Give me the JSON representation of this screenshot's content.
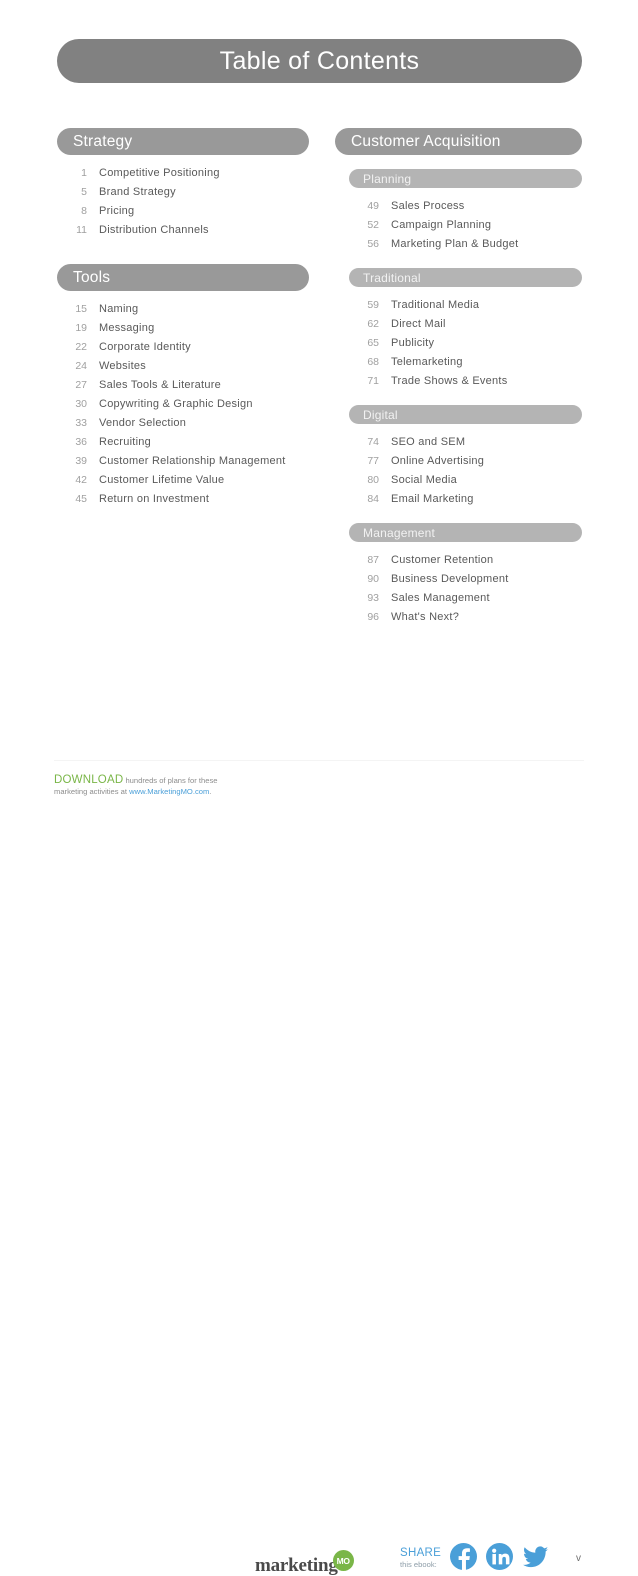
{
  "page": {
    "title": "Table of Contents",
    "page_number": "v"
  },
  "left_column": {
    "sections": [
      {
        "heading": "Strategy",
        "entries": [
          {
            "page": "1",
            "title": "Competitive Positioning"
          },
          {
            "page": "5",
            "title": "Brand Strategy"
          },
          {
            "page": "8",
            "title": "Pricing"
          },
          {
            "page": "11",
            "title": "Distribution Channels"
          }
        ]
      },
      {
        "heading": "Tools",
        "entries": [
          {
            "page": "15",
            "title": "Naming"
          },
          {
            "page": "19",
            "title": "Messaging"
          },
          {
            "page": "22",
            "title": "Corporate Identity"
          },
          {
            "page": "24",
            "title": "Websites"
          },
          {
            "page": "27",
            "title": "Sales Tools & Literature"
          },
          {
            "page": "30",
            "title": "Copywriting & Graphic Design"
          },
          {
            "page": "33",
            "title": "Vendor Selection"
          },
          {
            "page": "36",
            "title": "Recruiting"
          },
          {
            "page": "39",
            "title": "Customer Relationship Management"
          },
          {
            "page": "42",
            "title": "Customer Lifetime Value"
          },
          {
            "page": "45",
            "title": "Return on Investment"
          }
        ]
      }
    ]
  },
  "right_column": {
    "heading": "Customer Acquisition",
    "subsections": [
      {
        "heading": "Planning",
        "entries": [
          {
            "page": "49",
            "title": "Sales Process"
          },
          {
            "page": "52",
            "title": "Campaign Planning"
          },
          {
            "page": "56",
            "title": "Marketing Plan & Budget"
          }
        ]
      },
      {
        "heading": "Traditional",
        "entries": [
          {
            "page": "59",
            "title": "Traditional Media"
          },
          {
            "page": "62",
            "title": "Direct Mail"
          },
          {
            "page": "65",
            "title": "Publicity"
          },
          {
            "page": "68",
            "title": "Telemarketing"
          },
          {
            "page": "71",
            "title": "Trade Shows & Events"
          }
        ]
      },
      {
        "heading": "Digital",
        "entries": [
          {
            "page": "74",
            "title": "SEO and SEM"
          },
          {
            "page": "77",
            "title": "Online Advertising"
          },
          {
            "page": "80",
            "title": "Social Media"
          },
          {
            "page": "84",
            "title": "Email Marketing"
          }
        ]
      },
      {
        "heading": "Management",
        "entries": [
          {
            "page": "87",
            "title": "Customer Retention"
          },
          {
            "page": "90",
            "title": "Business Development"
          },
          {
            "page": "93",
            "title": "Sales Management"
          },
          {
            "page": "96",
            "title": "What's Next?"
          }
        ]
      }
    ]
  },
  "footer": {
    "download_word": "DOWNLOAD",
    "download_text_1": " hundreds of plans for these",
    "download_text_2": "marketing activities at ",
    "download_url": "www.MarketingMO.com",
    "download_text_3": ".",
    "logo_word": "marketing",
    "logo_mark": "MO",
    "share_word": "SHARE",
    "share_sub": "this ebook:",
    "social": [
      {
        "name": "facebook",
        "label": "Facebook"
      },
      {
        "name": "linkedin",
        "label": "LinkedIn"
      },
      {
        "name": "twitter",
        "label": "Twitter"
      }
    ]
  },
  "colors": {
    "title_bar": "#818181",
    "section_bar": "#999999",
    "sub_bar": "#b4b4b4",
    "entry_page": "#a0a0a0",
    "entry_title": "#595959",
    "green": "#7ab648",
    "blue": "#4a9fd8"
  }
}
